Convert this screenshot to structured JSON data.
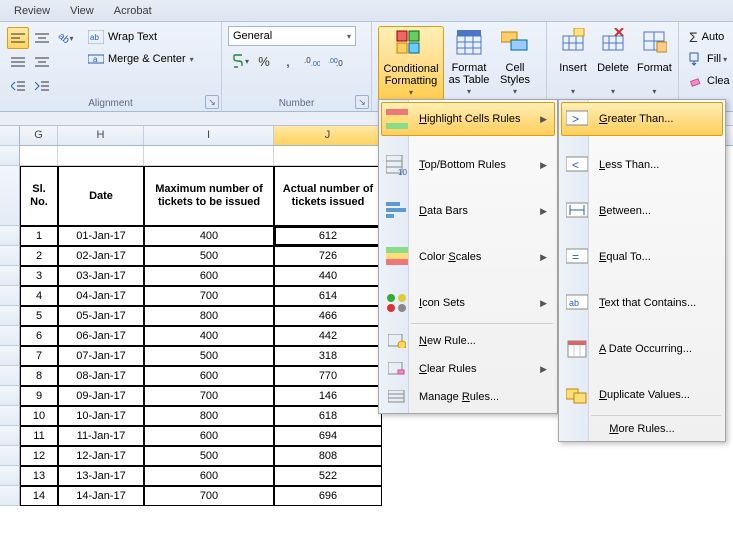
{
  "tabs": {
    "review": "Review",
    "view": "View",
    "acrobat": "Acrobat"
  },
  "alignment": {
    "label": "Alignment",
    "wrap": "Wrap Text",
    "merge": "Merge & Center"
  },
  "number": {
    "label": "Number",
    "format": "General"
  },
  "styles": {
    "cond": "Conditional\nFormatting",
    "fmt_table": "Format\nas Table",
    "cell_styles": "Cell\nStyles"
  },
  "cells": {
    "insert": "Insert",
    "delete": "Delete",
    "format": "Format"
  },
  "editing": {
    "auto": "Auto",
    "fill": "Fill",
    "clear": "Clea"
  },
  "cond_menu": {
    "highlight": "Highlight Cells Rules",
    "topbottom": "Top/Bottom Rules",
    "databars": "Data Bars",
    "colorscales": "Color Scales",
    "iconsets": "Icon Sets",
    "newrule": "New Rule...",
    "clearrules": "Clear Rules",
    "managerules": "Manage Rules..."
  },
  "hilite_menu": {
    "greater": "Greater Than...",
    "less": "Less Than...",
    "between": "Between...",
    "equal": "Equal To...",
    "textcontains": "Text that Contains...",
    "dateoccurring": "A Date Occurring...",
    "duplicate": "Duplicate Values...",
    "more": "More Rules..."
  },
  "columns": [
    "G",
    "H",
    "I",
    "J"
  ],
  "table": {
    "headers": {
      "slno": "Sl. No.",
      "date": "Date",
      "max": "Maximum number of tickets  to be issued",
      "actual": "Actual number of tickets issued"
    },
    "rows": [
      {
        "n": "1",
        "d": "01-Jan-17",
        "m": "400",
        "a": "612"
      },
      {
        "n": "2",
        "d": "02-Jan-17",
        "m": "500",
        "a": "726"
      },
      {
        "n": "3",
        "d": "03-Jan-17",
        "m": "600",
        "a": "440"
      },
      {
        "n": "4",
        "d": "04-Jan-17",
        "m": "700",
        "a": "614"
      },
      {
        "n": "5",
        "d": "05-Jan-17",
        "m": "800",
        "a": "466"
      },
      {
        "n": "6",
        "d": "06-Jan-17",
        "m": "400",
        "a": "442"
      },
      {
        "n": "7",
        "d": "07-Jan-17",
        "m": "500",
        "a": "318"
      },
      {
        "n": "8",
        "d": "08-Jan-17",
        "m": "600",
        "a": "770"
      },
      {
        "n": "9",
        "d": "09-Jan-17",
        "m": "700",
        "a": "146"
      },
      {
        "n": "10",
        "d": "10-Jan-17",
        "m": "800",
        "a": "618"
      },
      {
        "n": "11",
        "d": "11-Jan-17",
        "m": "600",
        "a": "694"
      },
      {
        "n": "12",
        "d": "12-Jan-17",
        "m": "500",
        "a": "808"
      },
      {
        "n": "13",
        "d": "13-Jan-17",
        "m": "600",
        "a": "522"
      },
      {
        "n": "14",
        "d": "14-Jan-17",
        "m": "700",
        "a": "696"
      }
    ]
  },
  "col_widths": {
    "rowhdr": 20,
    "G": 38,
    "H": 86,
    "I": 130,
    "J": 108
  }
}
